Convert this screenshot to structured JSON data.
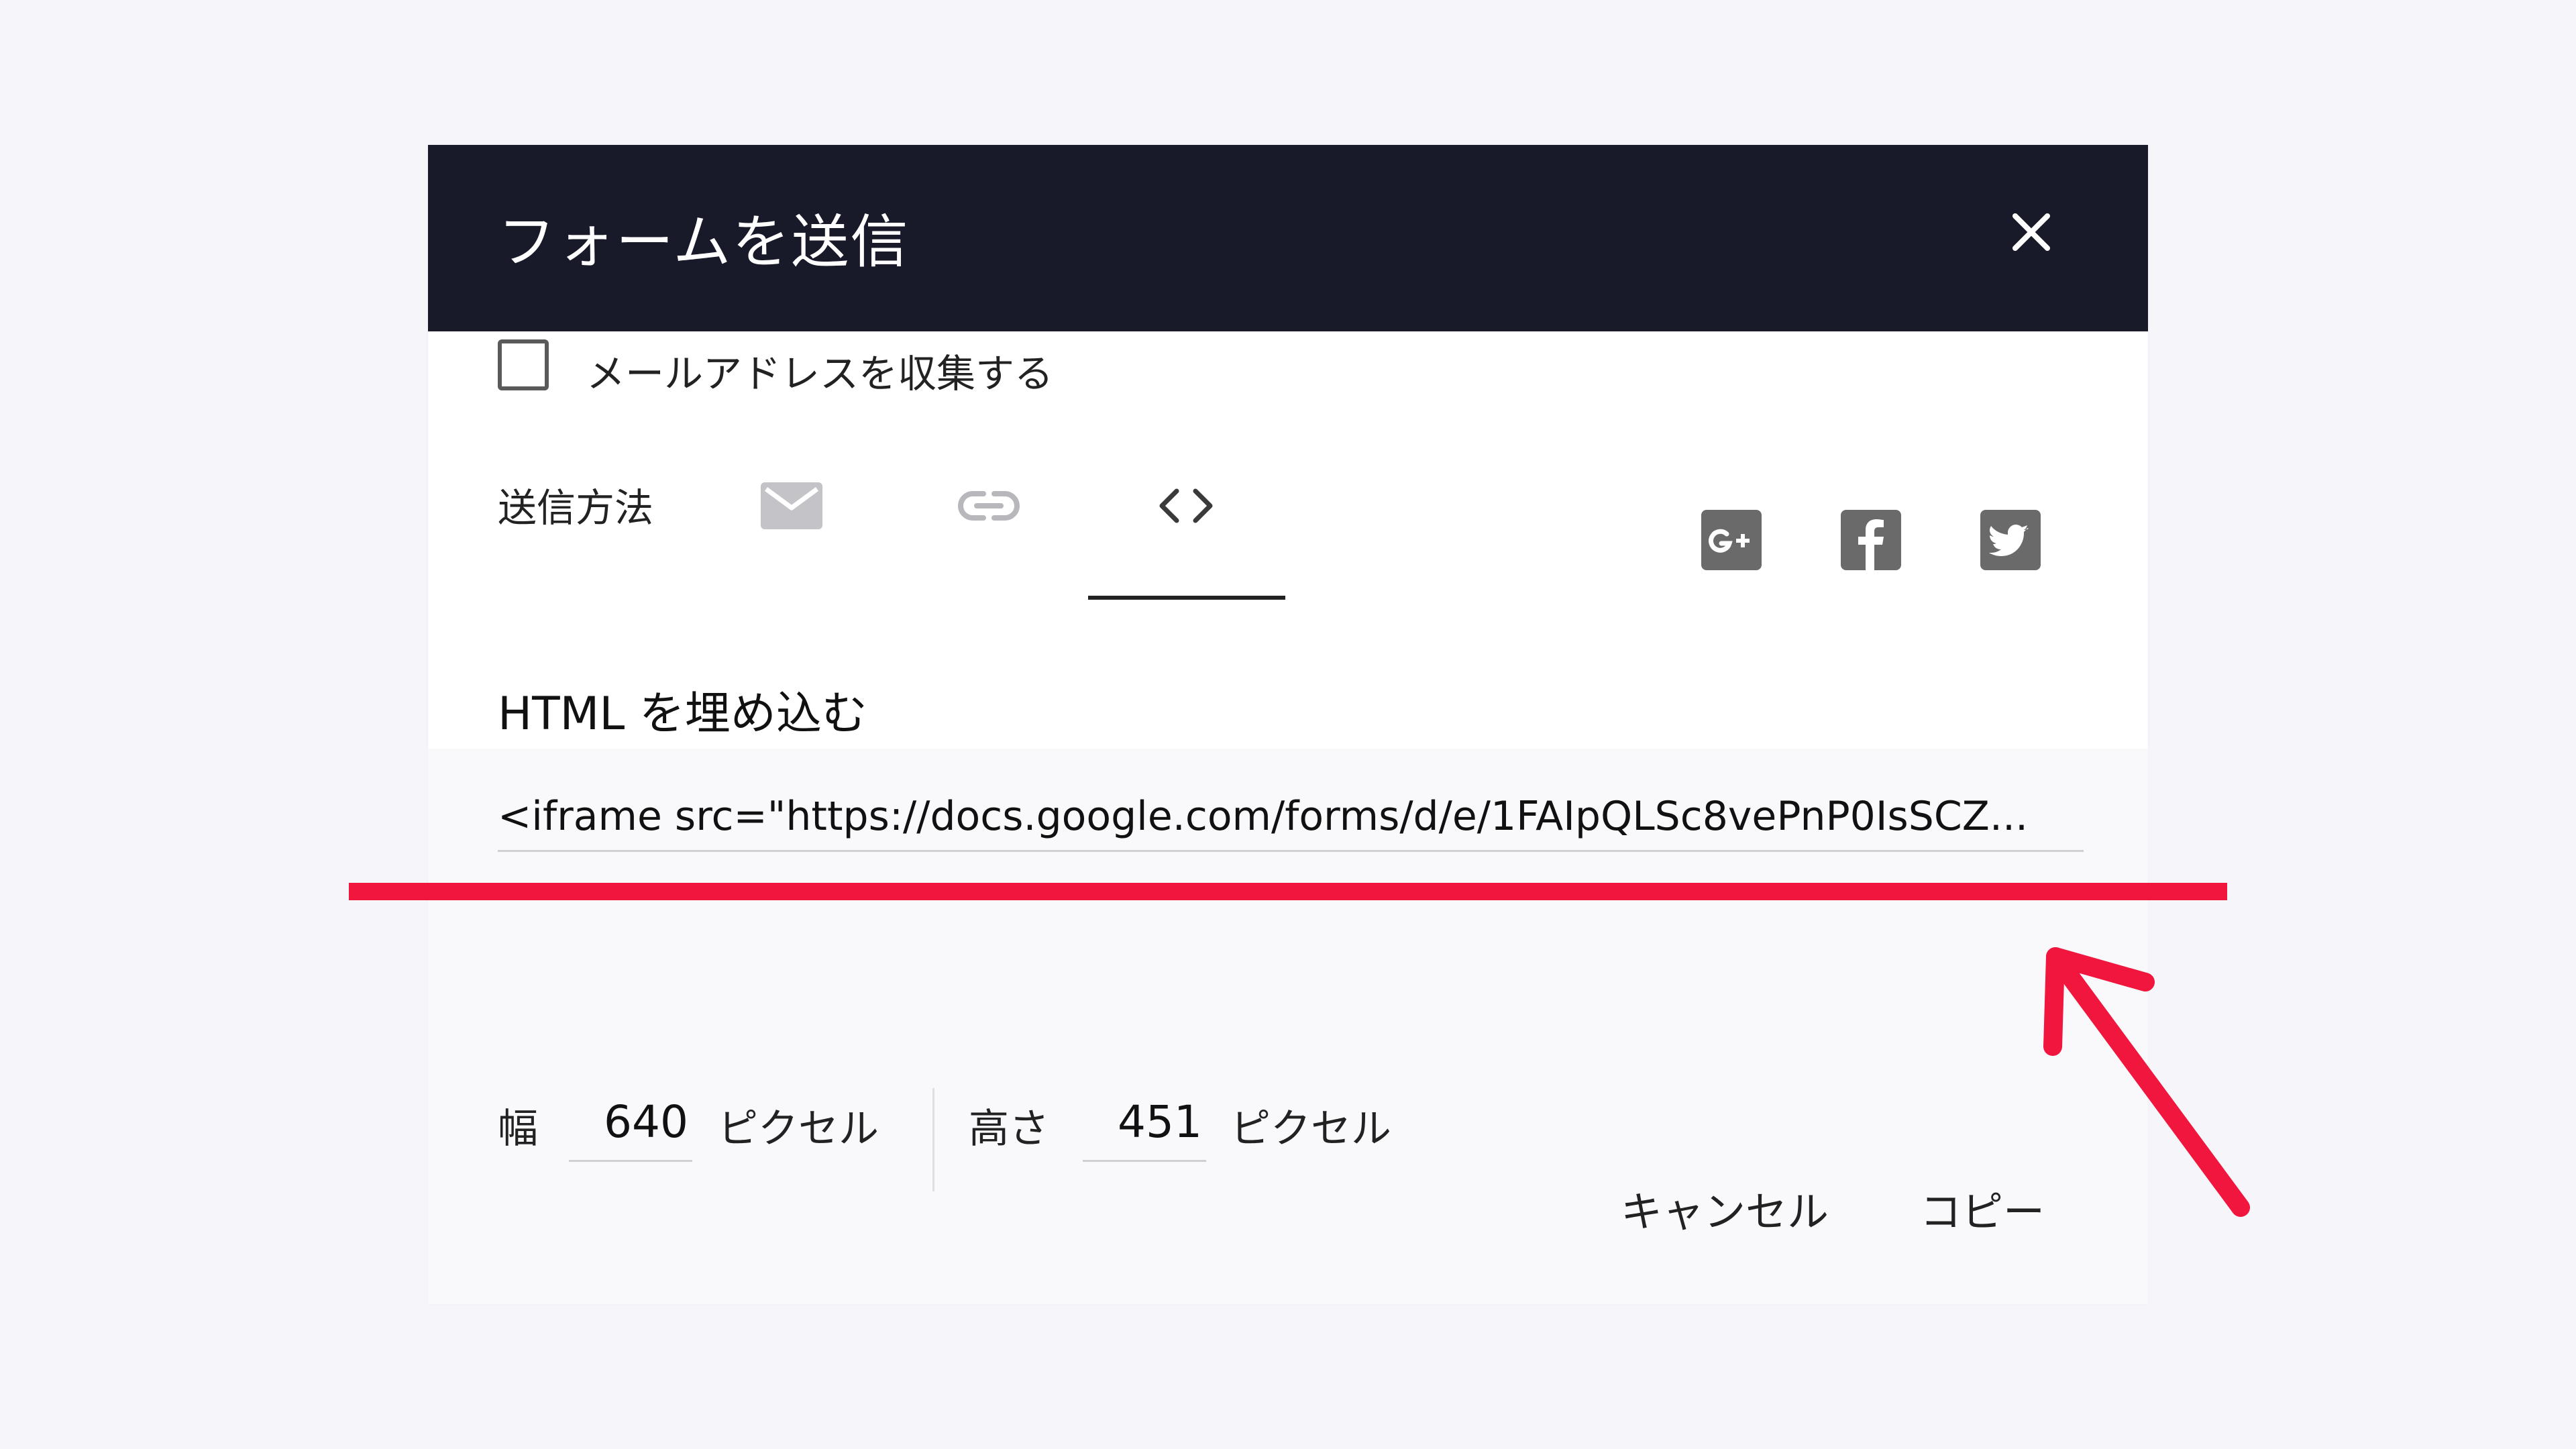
{
  "dialog": {
    "title": "フォームを送信",
    "close_icon": "close-icon"
  },
  "collect_email": {
    "checked": false,
    "label": "メールアドレスを収集する"
  },
  "send_via": {
    "label": "送信方法",
    "tabs": [
      {
        "icon": "email-icon",
        "selected": false
      },
      {
        "icon": "link-icon",
        "selected": false
      },
      {
        "icon": "embed-code-icon",
        "selected": true
      }
    ],
    "social": [
      "google-plus-icon",
      "facebook-icon",
      "twitter-icon"
    ]
  },
  "embed": {
    "title": "HTML を埋め込む",
    "code": "<iframe src=\"https://docs.google.com/forms/d/e/1FAIpQLSc8vePnP0IsSCZ..."
  },
  "dimensions": {
    "width_label": "幅",
    "width_value": "640",
    "width_unit": "ピクセル",
    "height_label": "高さ",
    "height_value": "451",
    "height_unit": "ピクセル"
  },
  "actions": {
    "cancel_label": "キャンセル",
    "copy_label": "コピー"
  },
  "colors": {
    "header_bg": "#181a29",
    "annotation_red": "#f0163d"
  }
}
